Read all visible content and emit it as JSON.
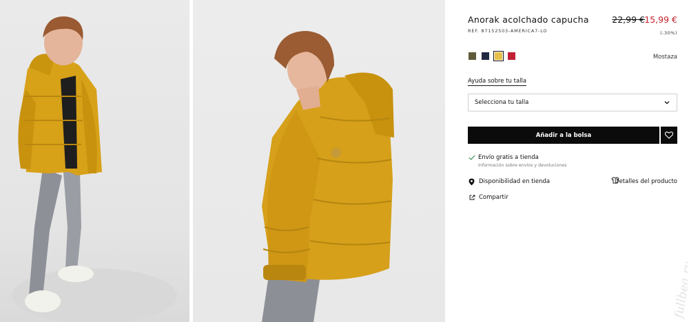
{
  "product": {
    "title": "Anorak acolchado capucha",
    "ref": "REF. 87152503-AMERICA7-LO",
    "old_price": "22,99 €",
    "new_price": "15,99 €",
    "discount": "(-30%)"
  },
  "colors": {
    "swatches": [
      {
        "name": "khaki",
        "hex": "#5e5b3a"
      },
      {
        "name": "navy",
        "hex": "#202940"
      },
      {
        "name": "mostaza",
        "hex": "#e7c04a",
        "selected": true
      },
      {
        "name": "red",
        "hex": "#c11f35"
      }
    ],
    "selected_name": "Mostaza"
  },
  "size": {
    "help_label": "Ayuda sobre tu talla",
    "select_label": "Selecciona tu talla"
  },
  "actions": {
    "add_to_bag": "Añadir a la bolsa",
    "favorite_icon": "heart-icon"
  },
  "shipping": {
    "title": "Envío gratis a tienda",
    "subtitle": "Información sobre envíos y devoluciones"
  },
  "links": {
    "store_availability": "Disponibilidad en tienda",
    "product_details": "Detalles del producto",
    "share": "Compartir"
  },
  "watermark": "fullbea.ru",
  "colors_theme": {
    "accent_price": "#c3222a",
    "button_bg": "#0b0b0b",
    "jacket": "#d9a21a"
  }
}
